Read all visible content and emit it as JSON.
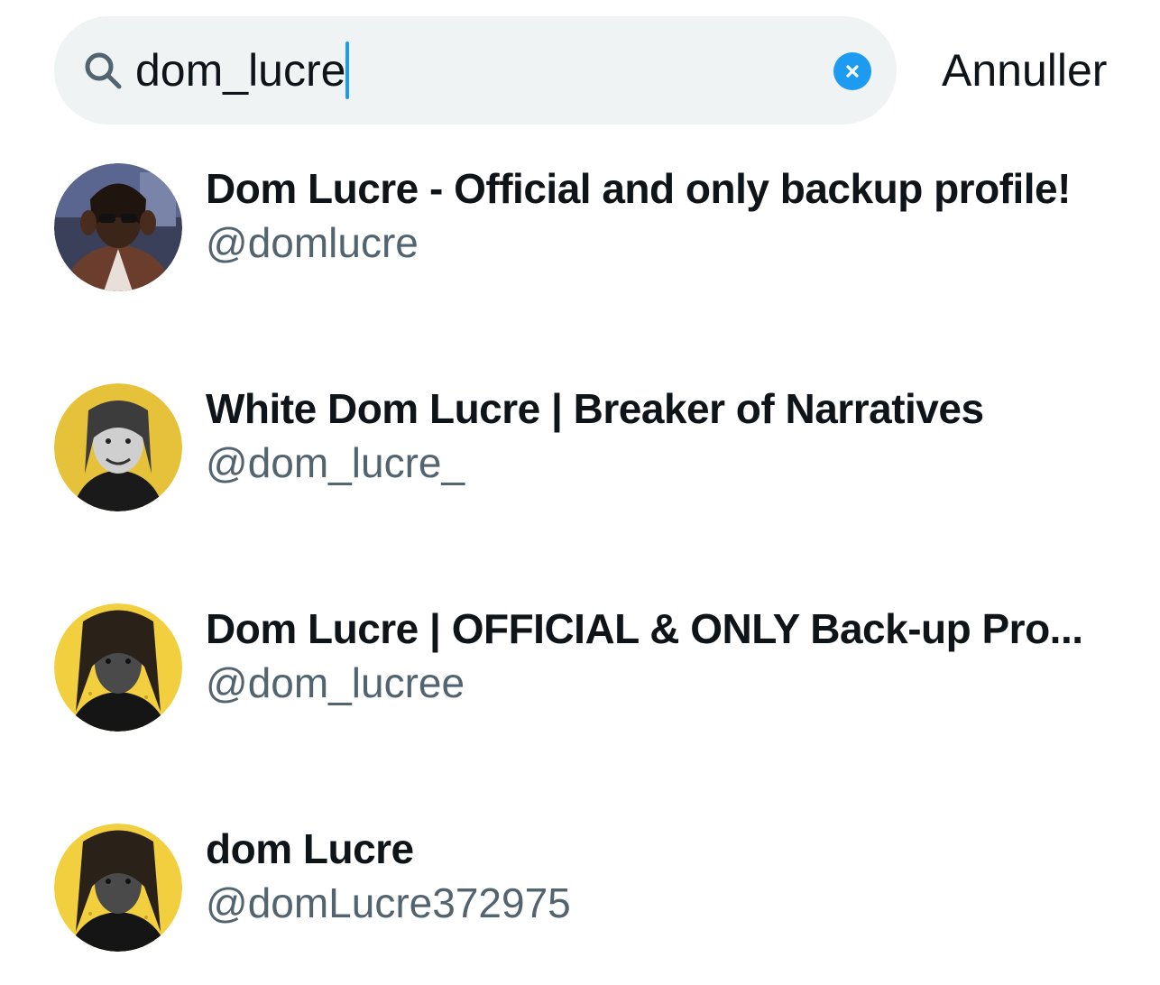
{
  "search": {
    "query": "dom_lucre",
    "cancel_label": "Annuller"
  },
  "colors": {
    "accent": "#1d9bf0",
    "search_bg": "#eff3f4",
    "secondary_text": "#536471"
  },
  "results": [
    {
      "name": "Dom Lucre - Official and only backup profile!",
      "handle": "@domlucre"
    },
    {
      "name": "White Dom Lucre | Breaker of Narratives",
      "handle": "@dom_lucre_"
    },
    {
      "name": "Dom Lucre | OFFICIAL & ONLY Back-up Pro...",
      "handle": "@dom_lucree"
    },
    {
      "name": "dom Lucre",
      "handle": "@domLucre372975"
    }
  ]
}
